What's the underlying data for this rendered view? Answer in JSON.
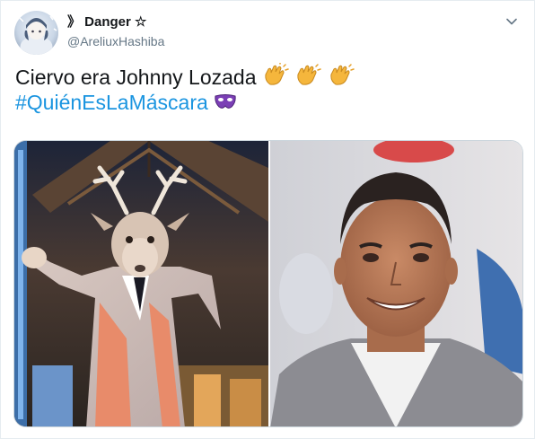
{
  "author": {
    "display_name": "》 Danger ☆",
    "handle": "@AreliuxHashiba"
  },
  "tweet": {
    "text": "Ciervo era Johnny Lozada",
    "hashtag": "#QuiénEsLaMáscara",
    "emojis": [
      "clapping-hands",
      "clapping-hands",
      "clapping-hands",
      "purple-mask"
    ]
  },
  "media": {
    "left_image": "masked-deer-costume-performer-photo",
    "right_image": "smiling-man-grey-blazer-photo"
  },
  "colors": {
    "text": "#14171a",
    "secondary": "#657786",
    "link": "#1b95e0",
    "border": "#e6ecf0"
  }
}
